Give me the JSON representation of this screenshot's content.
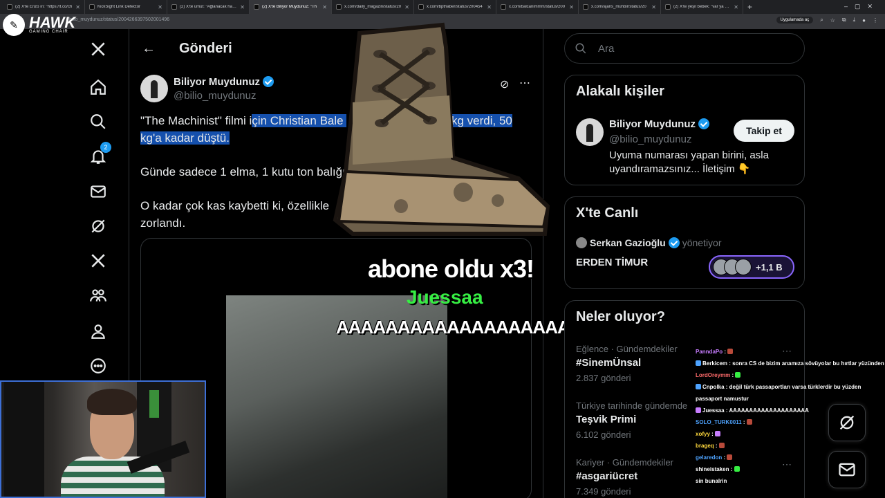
{
  "browser": {
    "tabs": [
      {
        "title": "(2) X'te Enzo ın: \"https://t.co/ch",
        "active": false
      },
      {
        "title": "KickSight Link Detector",
        "active": false
      },
      {
        "title": "(2) X'te umut: \"Ağlanacak halim",
        "active": false
      },
      {
        "title": "(2) X'te Biliyor Muydunuz: \"Th",
        "active": true
      },
      {
        "title": "x.com/daily_magazin/status/20",
        "active": false
      },
      {
        "title": "x.com/bpthaber/status/200454",
        "active": false
      },
      {
        "title": "x.com/balcanimmm/status/200",
        "active": false
      },
      {
        "title": "x.com/ajans_muhbir/status/20",
        "active": false
      },
      {
        "title": "(2) X'te yeşil bebek: \"var ya ağz",
        "active": false
      }
    ],
    "url": "bilio_muydunuz/status/2004266397502001496",
    "translate_pill": "Uygulamada aç"
  },
  "overlay_brand": {
    "name": "HAWK",
    "sub": "GAMING CHAIR"
  },
  "nav": {
    "notification_count": "2"
  },
  "header": {
    "title": "Gönderi"
  },
  "tweet": {
    "author_name": "Biliyor Muydunuz",
    "author_handle": "@bilio_muydunuz",
    "line1_pre": "\"The Machinist\" filmi i",
    "line1_hl": "çin Christian Bale ",
    "line1_gap": "",
    "line1_hl2": "29 kg verdi, 50",
    "line2_hl": "kg'a kadar düştü.",
    "para2": "Günde sadece 1 elma, 1 kutu ton balığı",
    "para3a": "O kadar çok kas kaybetti ki, özellikle",
    "para3b": "zorlandı."
  },
  "stream_overlay": {
    "alert_title": "abone oldu x3!",
    "alert_user": "Juessaa",
    "alert_message": "AAAAAAAAAAAAAAAAAAAA"
  },
  "search": {
    "placeholder": "Ara"
  },
  "related": {
    "title": "Alakalı kişiler",
    "name": "Biliyor Muydunuz",
    "handle": "@bilio_muydunuz",
    "bio": "Uyuma numarası yapan birini, asla uyandıramazsınız... İletişim 👇",
    "follow_label": "Takip et"
  },
  "live": {
    "title": "X'te Canlı",
    "host": "Serkan Gazioğlu",
    "host_role": "yönetiyor",
    "space_title": "ERDEN TİMUR",
    "listeners": "+1,1 B"
  },
  "trends": {
    "title": "Neler oluyor?",
    "items": [
      {
        "meta": "Eğlence · Gündemdekiler",
        "name": "#SinemÜnsal",
        "count": "2.837 gönderi"
      },
      {
        "meta": "Türkiye tarihinde gündemde",
        "name": "Teşvik Primi",
        "count": "6.102 gönderi"
      },
      {
        "meta": "Kariyer · Gündemdekiler",
        "name": "#asgariücret",
        "count": "7.349 gönderi"
      }
    ]
  },
  "chat": [
    {
      "user": "PanndaPo",
      "color": "#c77dff",
      "text": ""
    },
    {
      "user": "Berkicem",
      "color": "#ffffff",
      "text": "sonra CS de bizim anamıza sövüyolar bu hırtlar yüzünden"
    },
    {
      "user": "LordOreymm",
      "color": "#ff6b6b",
      "text": ""
    },
    {
      "user": "Cnpolka",
      "color": "#ffffff",
      "text": "değil türk passaportları varsa türklerdir bu yüzden passaport namustur"
    },
    {
      "user": "Juessaa",
      "color": "#ffffff",
      "text": "AAAAAAAAAAAAAAAAAAAA"
    },
    {
      "user": "SOLO_TURK0011",
      "color": "#4ea3ff",
      "text": ""
    },
    {
      "user": "xofyy",
      "color": "#ffd93d",
      "text": ""
    },
    {
      "user": "brageq",
      "color": "#ffd93d",
      "text": ""
    },
    {
      "user": "gelaredon",
      "color": "#4ea3ff",
      "text": ""
    },
    {
      "user": "shineistaken",
      "color": "#ffffff",
      "text": ""
    },
    {
      "user": "",
      "color": "#ffffff",
      "text": "sin bunalrin"
    }
  ]
}
